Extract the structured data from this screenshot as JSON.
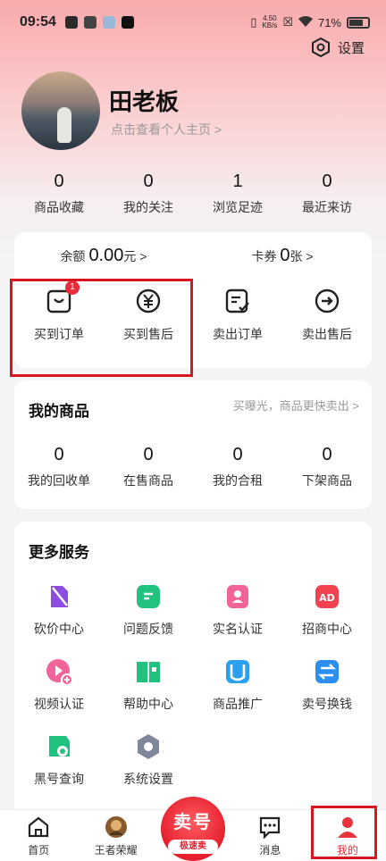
{
  "status_bar": {
    "time": "09:54",
    "speed_value": "4.50",
    "speed_unit": "KB/s",
    "battery": "71%"
  },
  "header": {
    "settings_label": "设置",
    "username": "田老板",
    "profile_link": "点击查看个人主页 >"
  },
  "stats": [
    {
      "value": "0",
      "label": "商品收藏"
    },
    {
      "value": "0",
      "label": "我的关注"
    },
    {
      "value": "1",
      "label": "浏览足迹"
    },
    {
      "value": "0",
      "label": "最近来访"
    }
  ],
  "wallet": {
    "balance_prefix": "余额",
    "balance_value": "0.00",
    "balance_suffix": "元 >",
    "coupon_prefix": "卡券",
    "coupon_value": "0",
    "coupon_suffix": "张 >"
  },
  "orders": [
    {
      "label": "买到订单",
      "icon": "bag-icon",
      "badge": "1"
    },
    {
      "label": "买到售后",
      "icon": "yen-icon"
    },
    {
      "label": "卖出订单",
      "icon": "doc-check-icon"
    },
    {
      "label": "卖出售后",
      "icon": "arrow-circle-icon"
    }
  ],
  "my_goods": {
    "title": "我的商品",
    "hint": "买曝光，商品更快卖出 >",
    "items": [
      {
        "value": "0",
        "label": "我的回收单"
      },
      {
        "value": "0",
        "label": "在售商品"
      },
      {
        "value": "0",
        "label": "我的合租"
      },
      {
        "value": "0",
        "label": "下架商品"
      }
    ]
  },
  "services": {
    "title": "更多服务",
    "items": [
      {
        "label": "砍价中心",
        "icon": "bargain-icon",
        "color": "#8e4de0"
      },
      {
        "label": "问题反馈",
        "icon": "feedback-icon",
        "color": "#21c27d"
      },
      {
        "label": "实名认证",
        "icon": "id-icon",
        "color": "#f0649a"
      },
      {
        "label": "招商中心",
        "icon": "ad-icon",
        "color": "#f0434f"
      },
      {
        "label": "视频认证",
        "icon": "video-icon",
        "color": "#f0649a"
      },
      {
        "label": "帮助中心",
        "icon": "book-icon",
        "color": "#21c27d"
      },
      {
        "label": "商品推广",
        "icon": "promote-icon",
        "color": "#2aa0ee"
      },
      {
        "label": "卖号换钱",
        "icon": "exchange-icon",
        "color": "#2a8ff0"
      },
      {
        "label": "黑号查询",
        "icon": "search-shield-icon",
        "color": "#21c27d"
      },
      {
        "label": "系统设置",
        "icon": "gear-icon",
        "color": "#7d8799"
      }
    ]
  },
  "tabbar": {
    "home": "首页",
    "game": "王者荣耀",
    "sell_top": "卖号",
    "sell_sub": "极速卖",
    "messages": "消息",
    "mine": "我的",
    "active_color": "#e5343e"
  }
}
